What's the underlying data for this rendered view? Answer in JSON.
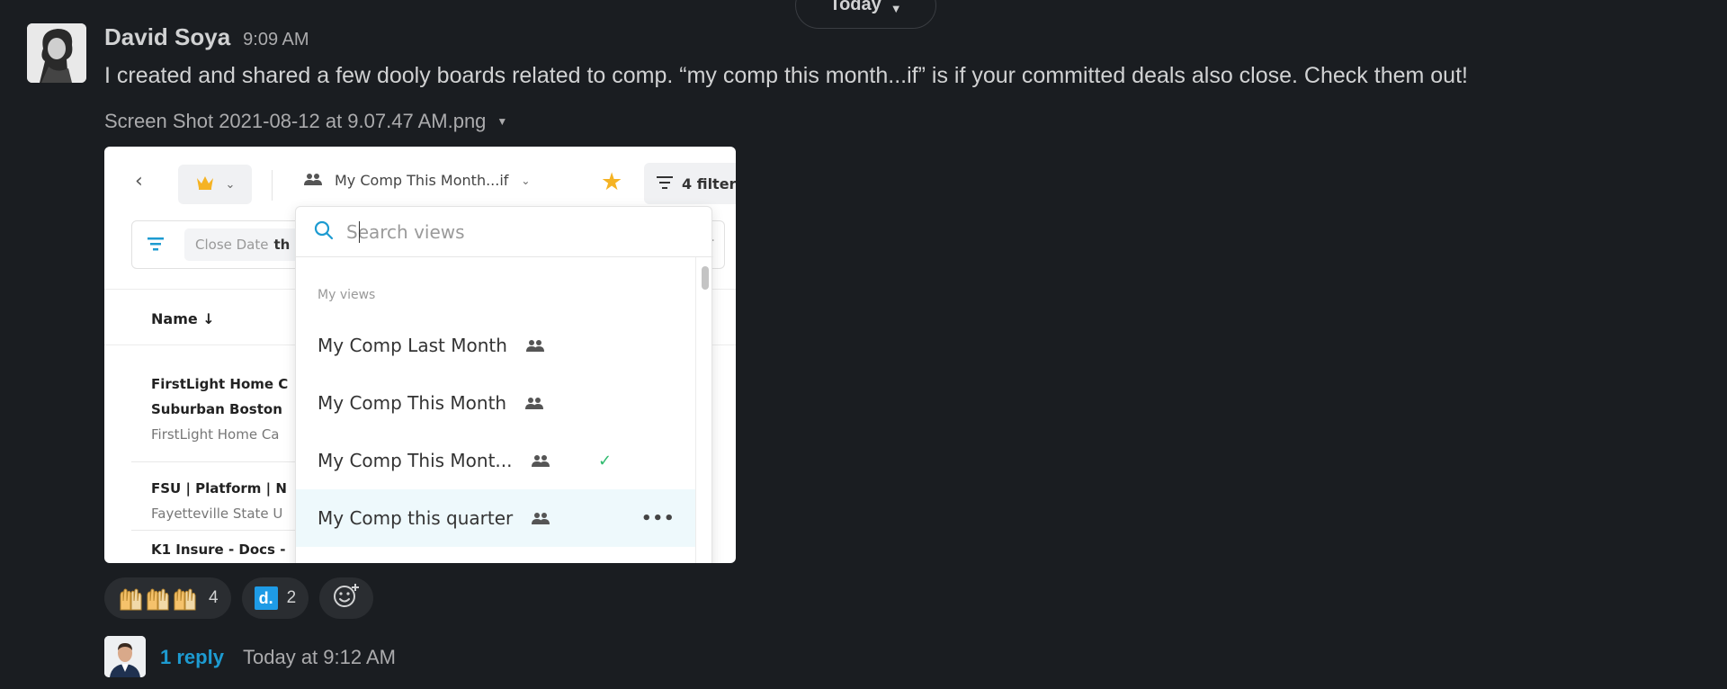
{
  "divider": {
    "label": "Today"
  },
  "message": {
    "author": "David Soya",
    "time": "9:09 AM",
    "text": "I created and shared a few dooly boards related to comp. “my comp this month...if” is if your committed deals also close. Check them out!",
    "attachment_name": "Screen Shot 2021-08-12 at 9.07.47 AM.png"
  },
  "screenshot": {
    "view_title": "My Comp This Month...if",
    "filters_label": "4 filter",
    "filter_chip_label": "Close Date",
    "filter_chip_value": "th",
    "table_header": "Name",
    "rows": [
      {
        "title": "FirstLight Home C",
        "title2": "Suburban Boston",
        "sub": "FirstLight Home Ca"
      },
      {
        "title": "FSU | Platform | N",
        "sub": "Fayetteville State U"
      },
      {
        "title": "K1 Insure - Docs -"
      }
    ],
    "dropdown": {
      "search_placeholder": "Search views",
      "section_label": "My views",
      "items": [
        {
          "label": "My Comp Last Month"
        },
        {
          "label": "My Comp This Month"
        },
        {
          "label": "My Comp This Mont...",
          "selected": true
        },
        {
          "label": "My Comp this quarter",
          "hovered": true
        }
      ]
    }
  },
  "reactions": [
    {
      "emoji": "raised-hands-icon",
      "count": "4"
    },
    {
      "emoji": "dooly-icon",
      "emoji_text": "d.",
      "count": "2"
    }
  ],
  "thread": {
    "replies": "1 reply",
    "last_reply": "Today at 9:12 AM"
  },
  "colors": {
    "background": "#1a1d21",
    "link": "#1d9bd1",
    "star": "#f5b324",
    "check": "#2fbb6e",
    "dooly": "#1e9be6"
  }
}
